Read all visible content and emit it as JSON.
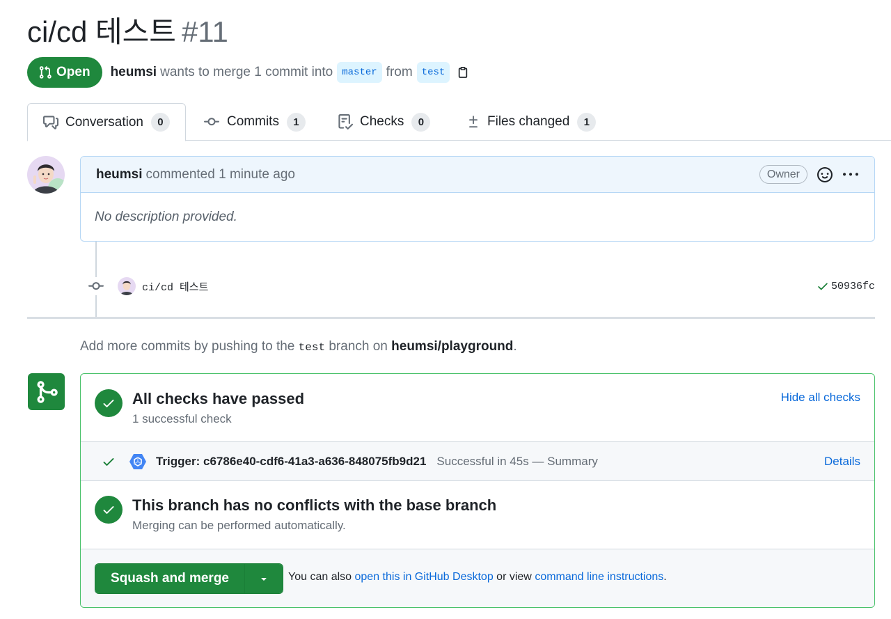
{
  "pr": {
    "title": "ci/cd 테스트",
    "number": "#11",
    "state": "Open",
    "author": "heumsi",
    "merge_text": "wants to merge 1 commit into",
    "base_branch": "master",
    "from_text": "from",
    "head_branch": "test"
  },
  "tabs": [
    {
      "label": "Conversation",
      "count": "0"
    },
    {
      "label": "Commits",
      "count": "1"
    },
    {
      "label": "Checks",
      "count": "0"
    },
    {
      "label": "Files changed",
      "count": "1"
    }
  ],
  "comment": {
    "author": "heumsi",
    "action": "commented",
    "time": "1 minute ago",
    "role_badge": "Owner",
    "body": "No description provided."
  },
  "commit": {
    "message": "ci/cd 테스트",
    "sha": "50936fc"
  },
  "hint": {
    "prefix": "Add more commits by pushing to the",
    "branch": "test",
    "middle": "branch on",
    "repo": "heumsi/playground",
    "suffix": "."
  },
  "checks": {
    "title": "All checks have passed",
    "subtitle": "1 successful check",
    "toggle_link": "Hide all checks",
    "item_name": "Trigger: c6786e40-cdf6-41a3-a636-848075fb9d21",
    "item_desc": "Successful in 45s — Summary",
    "item_link": "Details"
  },
  "conflicts": {
    "title": "This branch has no conflicts with the base branch",
    "subtitle": "Merging can be performed automatically."
  },
  "merge": {
    "button": "Squash and merge",
    "text_prefix": "You can also",
    "desktop_link": "open this in GitHub Desktop",
    "text_middle": "or view",
    "cli_link": "command line instructions",
    "text_suffix": "."
  },
  "colors": {
    "success": "#1f883d",
    "link": "#0969da",
    "branch_bg": "#ddf4ff"
  }
}
